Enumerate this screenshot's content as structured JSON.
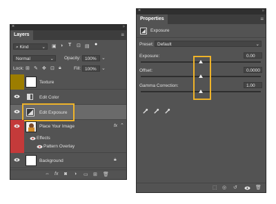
{
  "layers_panel": {
    "title": "Layers",
    "filter_kind": "Kind",
    "blend_mode": "Normal",
    "opacity_label": "Opacity:",
    "opacity_value": "100%",
    "lock_label": "Lock:",
    "fill_label": "Fill:",
    "fill_value": "100%",
    "layers": [
      {
        "name": "Texture"
      },
      {
        "name": "Edit Color"
      },
      {
        "name": "Edit Exposure"
      },
      {
        "name": "Place Your Image",
        "effects_label": "Effects",
        "effect_item": "Pattern Overlay",
        "fx": "fx"
      },
      {
        "name": "Background"
      }
    ],
    "footer_fx": "fx"
  },
  "properties_panel": {
    "title": "Properties",
    "adjustment_name": "Exposure",
    "preset_label": "Preset:",
    "preset_value": "Default",
    "sliders": [
      {
        "label": "Exposure:",
        "value": "0.00"
      },
      {
        "label": "Offset:",
        "value": "0.0000"
      },
      {
        "label": "Gamma Correction:",
        "value": "1.00"
      }
    ]
  },
  "colors": {
    "highlight": "#f0b429",
    "panel_bg": "#535353",
    "texture_swatch": "#9c7d00",
    "place_image_swatch": "#c43a3a"
  }
}
